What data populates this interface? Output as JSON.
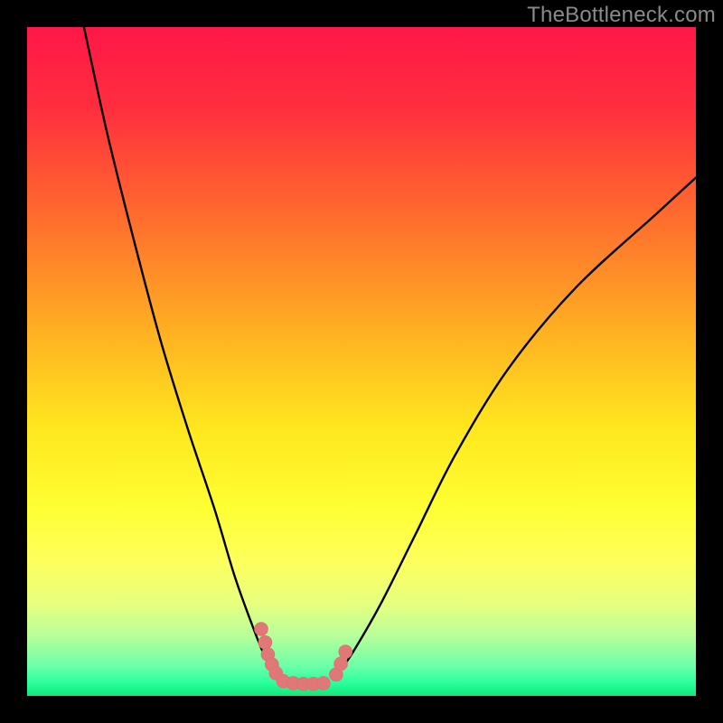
{
  "watermark": {
    "text": "TheBottleneck.com"
  },
  "chart_data": {
    "type": "line",
    "title": "",
    "xlabel": "",
    "ylabel": "",
    "xlim": [
      0,
      100
    ],
    "ylim": [
      0,
      100
    ],
    "background_gradient_stops": [
      {
        "offset": 0.0,
        "color": "#ff1748"
      },
      {
        "offset": 0.12,
        "color": "#ff2e3e"
      },
      {
        "offset": 0.28,
        "color": "#ff6a2e"
      },
      {
        "offset": 0.45,
        "color": "#ffae22"
      },
      {
        "offset": 0.6,
        "color": "#ffe71e"
      },
      {
        "offset": 0.72,
        "color": "#ffff33"
      },
      {
        "offset": 0.8,
        "color": "#fdff5d"
      },
      {
        "offset": 0.86,
        "color": "#e8ff7e"
      },
      {
        "offset": 0.91,
        "color": "#b8ff9a"
      },
      {
        "offset": 0.955,
        "color": "#6dffa8"
      },
      {
        "offset": 0.98,
        "color": "#2bff9e"
      },
      {
        "offset": 1.0,
        "color": "#10e87a"
      }
    ],
    "series": [
      {
        "name": "left-arm",
        "stroke": "#000000",
        "x": [
          8.5,
          12,
          16,
          20,
          24,
          28,
          31,
          33.5,
          35.5,
          37.5
        ],
        "y_pct": [
          100,
          84,
          68,
          53,
          40,
          28,
          18,
          11,
          6,
          2.5
        ]
      },
      {
        "name": "right-arm",
        "stroke": "#000000",
        "x": [
          46,
          49,
          53,
          58,
          64,
          72,
          82,
          94,
          100
        ],
        "y_pct": [
          2.5,
          7,
          14,
          24,
          36,
          49,
          61,
          72,
          77.5
        ]
      }
    ],
    "markers": [
      {
        "name": "left-cluster",
        "stroke": "#e27070",
        "fill": "#e07878",
        "points": [
          {
            "x": 35.0,
            "y_pct": 10.0
          },
          {
            "x": 35.6,
            "y_pct": 8.0
          },
          {
            "x": 36.0,
            "y_pct": 6.2
          },
          {
            "x": 36.6,
            "y_pct": 4.7
          },
          {
            "x": 37.2,
            "y_pct": 3.4
          }
        ]
      },
      {
        "name": "bottom-cluster",
        "stroke": "#e27070",
        "fill": "#e07878",
        "points": [
          {
            "x": 38.3,
            "y_pct": 2.2
          },
          {
            "x": 39.8,
            "y_pct": 1.9
          },
          {
            "x": 41.3,
            "y_pct": 1.8
          },
          {
            "x": 42.8,
            "y_pct": 1.8
          },
          {
            "x": 44.3,
            "y_pct": 1.9
          }
        ]
      },
      {
        "name": "right-cluster",
        "stroke": "#e27070",
        "fill": "#e07878",
        "points": [
          {
            "x": 46.2,
            "y_pct": 3.2
          },
          {
            "x": 46.9,
            "y_pct": 4.8
          },
          {
            "x": 47.6,
            "y_pct": 6.6
          }
        ]
      }
    ]
  }
}
